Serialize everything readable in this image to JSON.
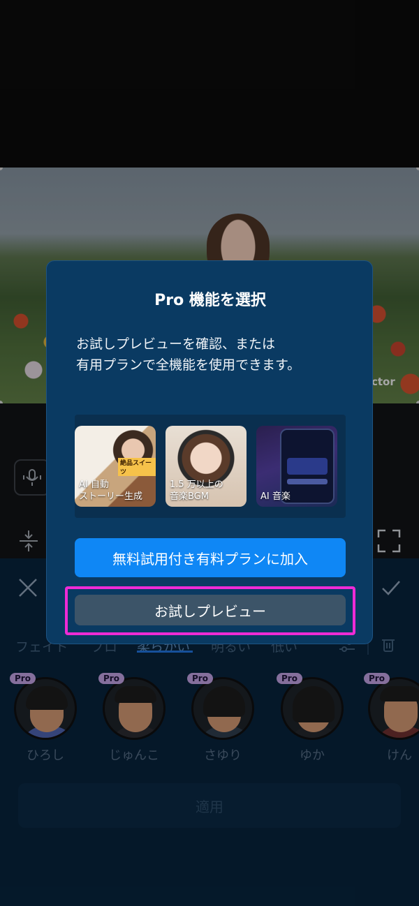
{
  "preview": {
    "watermark": "ctor"
  },
  "editor": {
    "filter_tabs": [
      {
        "label": "フェイド"
      },
      {
        "label": "プロ"
      },
      {
        "label": "柔らかい"
      },
      {
        "label": "明るい"
      },
      {
        "label": "低い"
      }
    ],
    "avatars": [
      {
        "name": "ひろし",
        "badge": "Pro"
      },
      {
        "name": "じゅんこ",
        "badge": "Pro"
      },
      {
        "name": "さゆり",
        "badge": "Pro"
      },
      {
        "name": "ゆか",
        "badge": "Pro"
      },
      {
        "name": "けん",
        "badge": "Pro"
      }
    ],
    "apply_label": "適用"
  },
  "modal": {
    "title": "Pro 機能を選択",
    "body_line1": "お試しプレビューを確認、または",
    "body_line2": "有用プランで全機能を使用できます。",
    "features": [
      {
        "line1": "AI 自動",
        "line2": "ストーリー生成",
        "badge": "絶品スイーツ"
      },
      {
        "line1": "1.5 万以上の",
        "line2": "音楽BGM"
      },
      {
        "line1": "AI 音楽",
        "line2": ""
      }
    ],
    "primary_button": "無料試用付き有料プランに加入",
    "secondary_button": "お試しプレビュー"
  },
  "colors": {
    "accent": "#0f87f5",
    "highlight": "#ee2bd6",
    "modal_bg": "#0a3a62"
  }
}
